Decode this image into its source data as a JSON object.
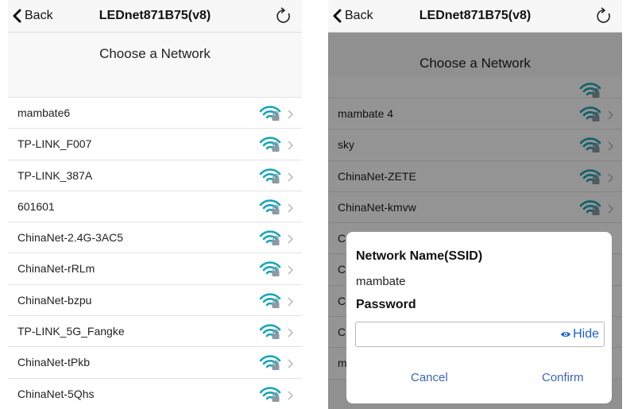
{
  "left_screen": {
    "nav": {
      "back_label": "Back",
      "title": "LEDnet871B75(v8)"
    },
    "heading": "Choose a Network",
    "networks": [
      {
        "ssid": "mambate6"
      },
      {
        "ssid": "TP-LINK_F007"
      },
      {
        "ssid": "TP-LINK_387A"
      },
      {
        "ssid": "601601"
      },
      {
        "ssid": "ChinaNet-2.4G-3AC5"
      },
      {
        "ssid": "ChinaNet-rRLm"
      },
      {
        "ssid": "ChinaNet-bzpu"
      },
      {
        "ssid": "TP-LINK_5G_Fangke"
      },
      {
        "ssid": "ChinaNet-tPkb"
      },
      {
        "ssid": "ChinaNet-5Qhs"
      }
    ]
  },
  "right_screen": {
    "nav": {
      "back_label": "Back",
      "title": "LEDnet871B75(v8)"
    },
    "heading": "Choose a Network",
    "networks": [
      {
        "ssid": "mambate 4"
      },
      {
        "ssid": "sky"
      },
      {
        "ssid": "ChinaNet-ZETE"
      },
      {
        "ssid": "ChinaNet-kmvw"
      },
      {
        "ssid": "C"
      },
      {
        "ssid": "C"
      },
      {
        "ssid": "C"
      },
      {
        "ssid": "C"
      },
      {
        "ssid": "mambate"
      }
    ],
    "dialog": {
      "ssid_label": "Network Name(SSID)",
      "ssid_value": "mambate",
      "password_label": "Password",
      "password_value": "",
      "toggle_label": "Hide",
      "cancel_label": "Cancel",
      "confirm_label": "Confirm"
    }
  },
  "icons": {
    "back": "chevron-left-icon",
    "refresh": "refresh-icon",
    "wifi": "wifi-locked-icon",
    "row_chevron": "chevron-right-icon",
    "toggle": "eye-icon"
  },
  "colors": {
    "wifi_teal": "#1aa6b7",
    "lock_gray": "#8d9aa3",
    "link_blue": "#3c66b5",
    "hide_blue": "#1a63c9",
    "overlay": "rgba(0,0,0,0.42)"
  }
}
